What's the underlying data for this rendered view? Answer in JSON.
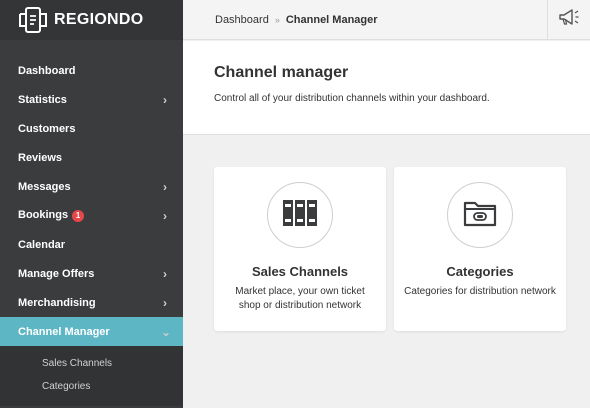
{
  "brand": {
    "name": "REGIONDO"
  },
  "breadcrumb": {
    "home": "Dashboard",
    "separator": "»",
    "current": "Channel Manager"
  },
  "sidebar": {
    "items": [
      {
        "label": "Dashboard",
        "has_submenu": false
      },
      {
        "label": "Statistics",
        "has_submenu": true
      },
      {
        "label": "Customers",
        "has_submenu": false
      },
      {
        "label": "Reviews",
        "has_submenu": false
      },
      {
        "label": "Messages",
        "has_submenu": true
      },
      {
        "label": "Bookings",
        "badge": "1",
        "has_submenu": true
      },
      {
        "label": "Calendar",
        "has_submenu": false
      },
      {
        "label": "Manage Offers",
        "has_submenu": true
      },
      {
        "label": "Merchandising",
        "has_submenu": true
      },
      {
        "label": "Channel Manager",
        "has_submenu": true,
        "active": true,
        "expanded": true
      }
    ],
    "subitems": [
      {
        "label": "Sales Channels"
      },
      {
        "label": "Categories"
      }
    ],
    "chevron_collapsed": "›",
    "chevron_expanded": "⌄"
  },
  "page": {
    "title": "Channel manager",
    "subtitle": "Control all of your distribution channels within your dashboard."
  },
  "cards": [
    {
      "title": "Sales Channels",
      "description": "Market place, your own ticket shop or distribution network",
      "icon": "binders-icon"
    },
    {
      "title": "Categories",
      "description": "Categories for distribution network",
      "icon": "folder-icon"
    }
  ],
  "colors": {
    "sidebar_bg": "#3a3c3e",
    "active_bg": "#5db6c4",
    "badge": "#e8474a",
    "content_bg": "#f0f0f0"
  },
  "icons": {
    "announcements": "megaphone-icon",
    "logo": "regiondo-logo-icon"
  }
}
